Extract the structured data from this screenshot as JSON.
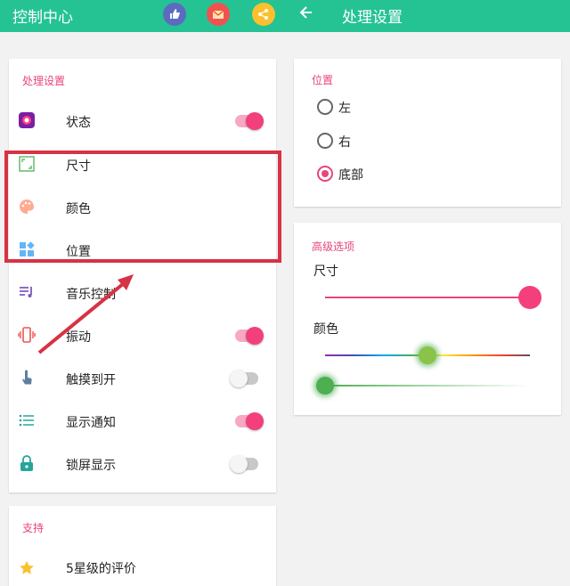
{
  "app": {
    "title": "控制中心",
    "right_title": "处理设置"
  },
  "top_icons": [
    {
      "name": "thumbs-up-icon",
      "color": "#5c6bc0"
    },
    {
      "name": "mail-icon",
      "color": "#ef5350"
    },
    {
      "name": "share-icon",
      "color": "#fbc02d"
    }
  ],
  "left_panel": {
    "section_title": "处理设置",
    "items": [
      {
        "label": "状态",
        "icon": "status-icon",
        "toggle": "on"
      },
      {
        "label": "尺寸",
        "icon": "size-icon"
      },
      {
        "label": "颜色",
        "icon": "palette-icon"
      },
      {
        "label": "位置",
        "icon": "position-icon"
      },
      {
        "label": "音乐控制",
        "icon": "music-icon"
      },
      {
        "label": "振动",
        "icon": "vibrate-icon",
        "toggle": "on"
      },
      {
        "label": "触摸到开",
        "icon": "touch-icon",
        "toggle": "off"
      },
      {
        "label": "显示通知",
        "icon": "list-icon",
        "toggle": "on"
      },
      {
        "label": "锁屏显示",
        "icon": "lock-icon",
        "toggle": "off"
      }
    ]
  },
  "support": {
    "title": "支持",
    "item_label": "5星级的评价"
  },
  "position_card": {
    "title": "位置",
    "options": [
      {
        "label": "左",
        "checked": false
      },
      {
        "label": "右",
        "checked": false
      },
      {
        "label": "底部",
        "checked": true
      }
    ]
  },
  "advanced_card": {
    "title": "高级选项",
    "size_label": "尺寸",
    "size_value": 1.0,
    "color_label": "颜色",
    "hue_value": 0.5,
    "alpha_value": 0.0
  },
  "colors": {
    "accent": "#e8457a",
    "topbar": "#25c294",
    "highlight": "#d63344"
  }
}
